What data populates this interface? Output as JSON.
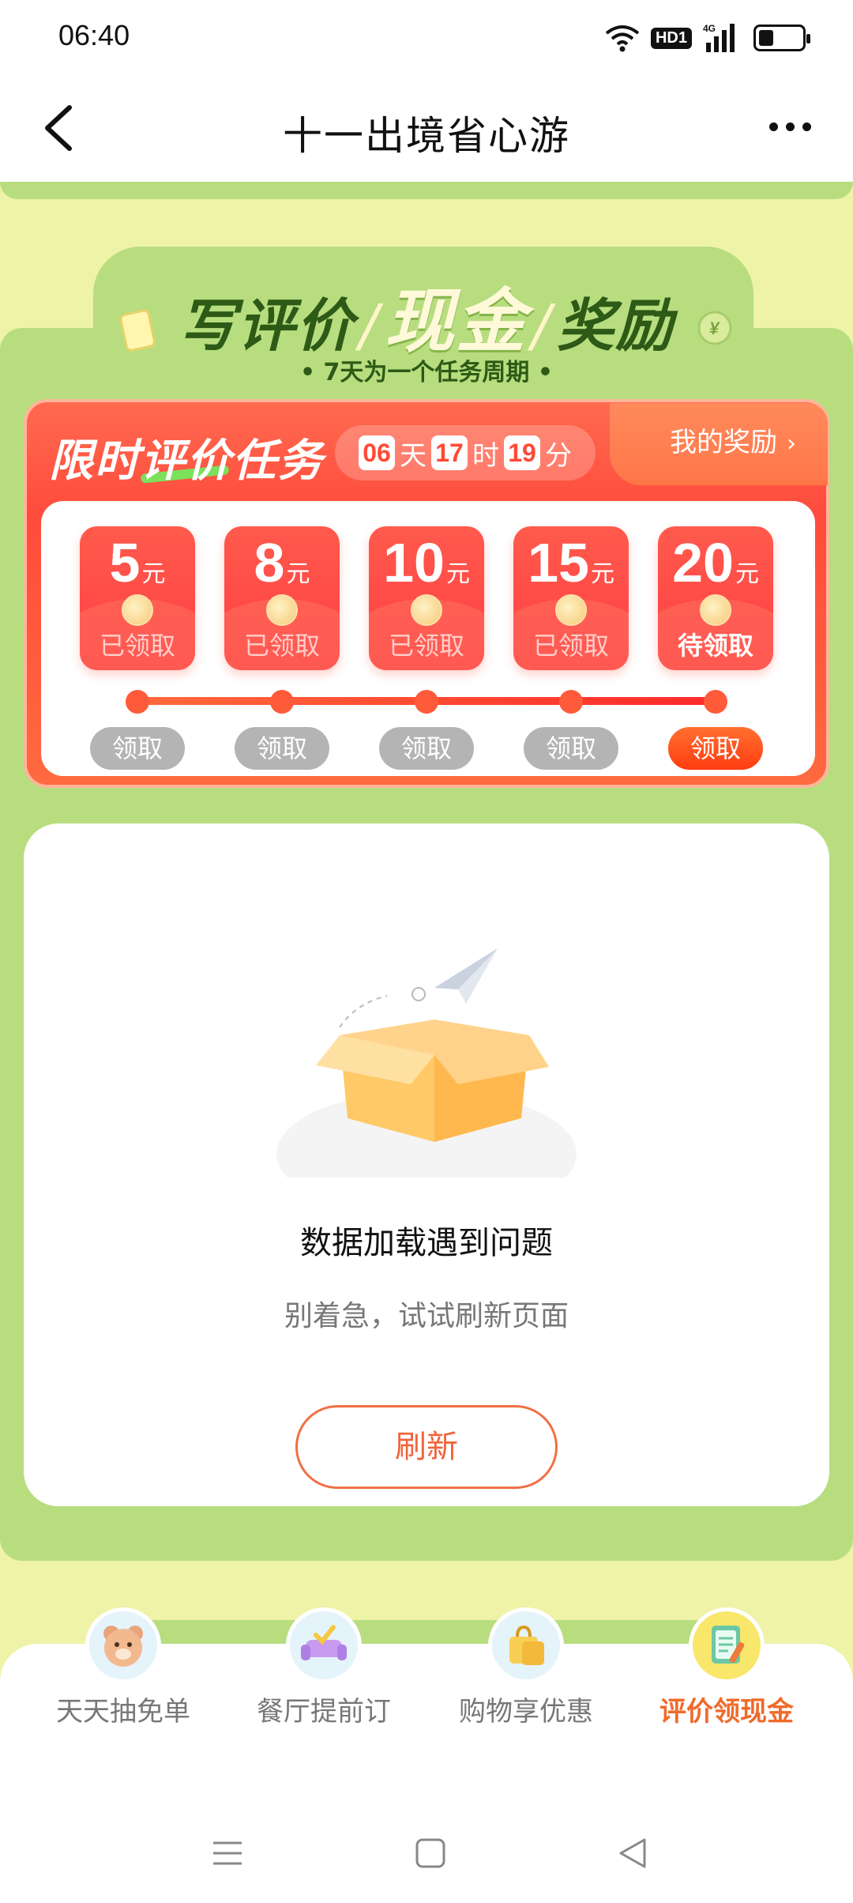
{
  "status_bar": {
    "time": "06:40",
    "network": "4G",
    "hd_badge": "HD1",
    "icons": [
      "wifi-icon",
      "hd-icon",
      "signal-icon",
      "battery-icon"
    ]
  },
  "nav": {
    "title": "十一出境省心游",
    "back_icon": "chevron-left-icon",
    "more_icon": "more-dots-icon"
  },
  "banner": {
    "title_part1": "写评价",
    "title_cash": "现金",
    "title_part2": "奖励",
    "subtitle": "• 7天为一个任务周期 •"
  },
  "task": {
    "title": "限时评价任务",
    "countdown": {
      "days": "06",
      "days_unit": "天",
      "hours": "17",
      "hours_unit": "时",
      "minutes": "19",
      "minutes_unit": "分"
    },
    "my_reward": "我的奖励",
    "rewards": [
      {
        "amount": "5",
        "unit": "元",
        "status": "已领取",
        "button": "领取",
        "active": false
      },
      {
        "amount": "8",
        "unit": "元",
        "status": "已领取",
        "button": "领取",
        "active": false
      },
      {
        "amount": "10",
        "unit": "元",
        "status": "已领取",
        "button": "领取",
        "active": false
      },
      {
        "amount": "15",
        "unit": "元",
        "status": "已领取",
        "button": "领取",
        "active": false
      },
      {
        "amount": "20",
        "unit": "元",
        "status": "待领取",
        "button": "领取",
        "active": true
      }
    ]
  },
  "empty_state": {
    "title": "数据加载遇到问题",
    "subtitle": "别着急，试试刷新页面",
    "refresh_button": "刷新"
  },
  "tabs": [
    {
      "label": "天天抽免单",
      "icon": "bear-icon",
      "active": false
    },
    {
      "label": "餐厅提前订",
      "icon": "sofa-icon",
      "active": false
    },
    {
      "label": "购物享优惠",
      "icon": "shopping-bag-icon",
      "active": false
    },
    {
      "label": "评价领现金",
      "icon": "notepad-icon",
      "active": true
    }
  ],
  "colors": {
    "green_bg": "#b7dd7f",
    "pale_bg": "#eef3a8",
    "task_red": "#ff4b3c",
    "accent_orange": "#f06a2a"
  }
}
